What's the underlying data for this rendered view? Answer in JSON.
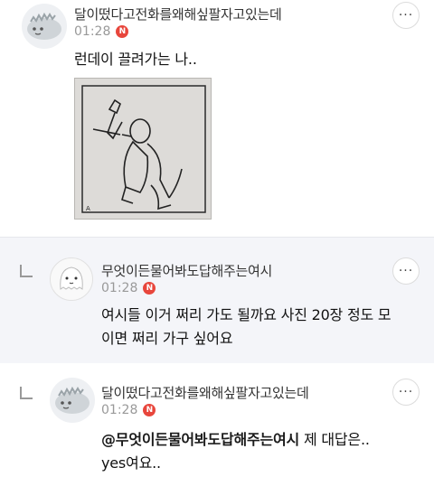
{
  "comments": [
    {
      "author": "달이떴다고전화를왜해싶팔자고있는데",
      "time": "01:28",
      "badge": "N",
      "text": "런데이 끌려가는 나..",
      "avatar_icon": "dinosaur-icon",
      "has_image": true
    },
    {
      "author": "무엇이든물어봐도답해주는여시",
      "time": "01:28",
      "badge": "N",
      "text_line1": "여시들 이거 쩌리 가도 될까요 사진 20장 정도 모",
      "text_line2": "이면 쩌리 가구 싶어요",
      "avatar_icon": "ghost-face-icon",
      "is_reply": true
    },
    {
      "author": "달이떴다고전화를왜해싶팔자고있는데",
      "time": "01:28",
      "badge": "N",
      "mention": "@무엇이든물어봐도답해주는여시",
      "text_line1": "제 대답은..",
      "text_line2": "yes여요..",
      "avatar_icon": "dinosaur-icon",
      "is_reply": true
    }
  ],
  "more_button_label": "···",
  "colors": {
    "badge": "#e8463c",
    "reply_bg": "#f4f5f9",
    "meta": "#999999"
  }
}
